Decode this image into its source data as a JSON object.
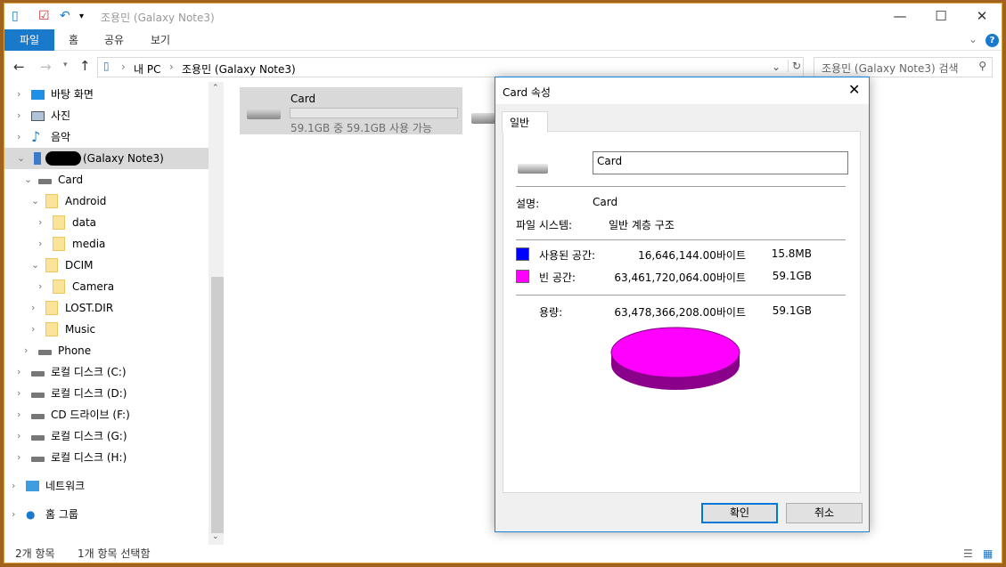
{
  "window": {
    "title": "조용민 (Galaxy Note3)",
    "controls": {
      "minimize": "—",
      "maximize": "☐",
      "close": "✕"
    }
  },
  "ribbon": {
    "tabs": [
      "파일",
      "홈",
      "공유",
      "보기"
    ]
  },
  "address": {
    "path": [
      "내 PC",
      "조용민 (Galaxy Note3)"
    ],
    "search_placeholder": "조용민 (Galaxy Note3) 검색"
  },
  "nav": {
    "items": [
      {
        "label": "바탕 화면",
        "icon": "desktop-icon",
        "level": 0,
        "expanded": false
      },
      {
        "label": "사진",
        "icon": "pictures-icon",
        "level": 0,
        "expanded": false
      },
      {
        "label": "음악",
        "icon": "music-icon",
        "level": 0,
        "expanded": false
      },
      {
        "label": "(Galaxy Note3)",
        "icon": "phone-icon",
        "level": 0,
        "expanded": true,
        "selected": true
      },
      {
        "label": "Card",
        "icon": "drive-icon",
        "level": 1,
        "expanded": true
      },
      {
        "label": "Android",
        "icon": "folder-icon",
        "level": 2,
        "expanded": true
      },
      {
        "label": "data",
        "icon": "folder-icon",
        "level": 3,
        "expanded": false
      },
      {
        "label": "media",
        "icon": "folder-icon",
        "level": 3,
        "expanded": false
      },
      {
        "label": "DCIM",
        "icon": "folder-icon",
        "level": 2,
        "expanded": true
      },
      {
        "label": "Camera",
        "icon": "folder-icon",
        "level": 3,
        "expanded": false
      },
      {
        "label": "LOST.DIR",
        "icon": "folder-icon",
        "level": 2,
        "expanded": false
      },
      {
        "label": "Music",
        "icon": "folder-icon",
        "level": 2,
        "expanded": false
      },
      {
        "label": "Phone",
        "icon": "drive-icon",
        "level": 1,
        "expanded": false
      },
      {
        "label": "로컬 디스크 (C:)",
        "icon": "drive-icon",
        "level": 0,
        "expanded": false
      },
      {
        "label": "로컬 디스크 (D:)",
        "icon": "drive-icon",
        "level": 0,
        "expanded": false
      },
      {
        "label": "CD 드라이브 (F:)",
        "icon": "cd-drive-icon",
        "level": 0,
        "expanded": false
      },
      {
        "label": "로컬 디스크 (G:)",
        "icon": "drive-icon",
        "level": 0,
        "expanded": false
      },
      {
        "label": "로컬 디스크 (H:)",
        "icon": "drive-icon",
        "level": 0,
        "expanded": false
      },
      {
        "label": "네트워크",
        "icon": "network-icon",
        "level": -1,
        "expanded": false
      },
      {
        "label": "홈 그룹",
        "icon": "homegroup-icon",
        "level": -1,
        "expanded": false
      }
    ]
  },
  "content": {
    "tile": {
      "name": "Card",
      "free_text": "59.1GB 중 59.1GB 사용 가능",
      "used_fraction": 0.0003
    }
  },
  "status": {
    "count": "2개 항목",
    "selected": "1개 항목 선택함"
  },
  "dialog": {
    "title": "Card 속성",
    "tab": "일반",
    "name_value": "Card",
    "desc_label": "설명:",
    "desc_value": "Card",
    "fs_label": "파일 시스템:",
    "fs_value": "일반 계층 구조",
    "used": {
      "label": "사용된 공간:",
      "bytes": "16,646,144.00바이트",
      "size": "15.8MB",
      "color": "#0000ff"
    },
    "free": {
      "label": "빈 공간:",
      "bytes": "63,461,720,064.00바이트",
      "size": "59.1GB",
      "color": "#ff00ff"
    },
    "capacity": {
      "label": "용량:",
      "bytes": "63,478,366,208.00바이트",
      "size": "59.1GB"
    },
    "ok": "확인",
    "cancel": "취소"
  }
}
